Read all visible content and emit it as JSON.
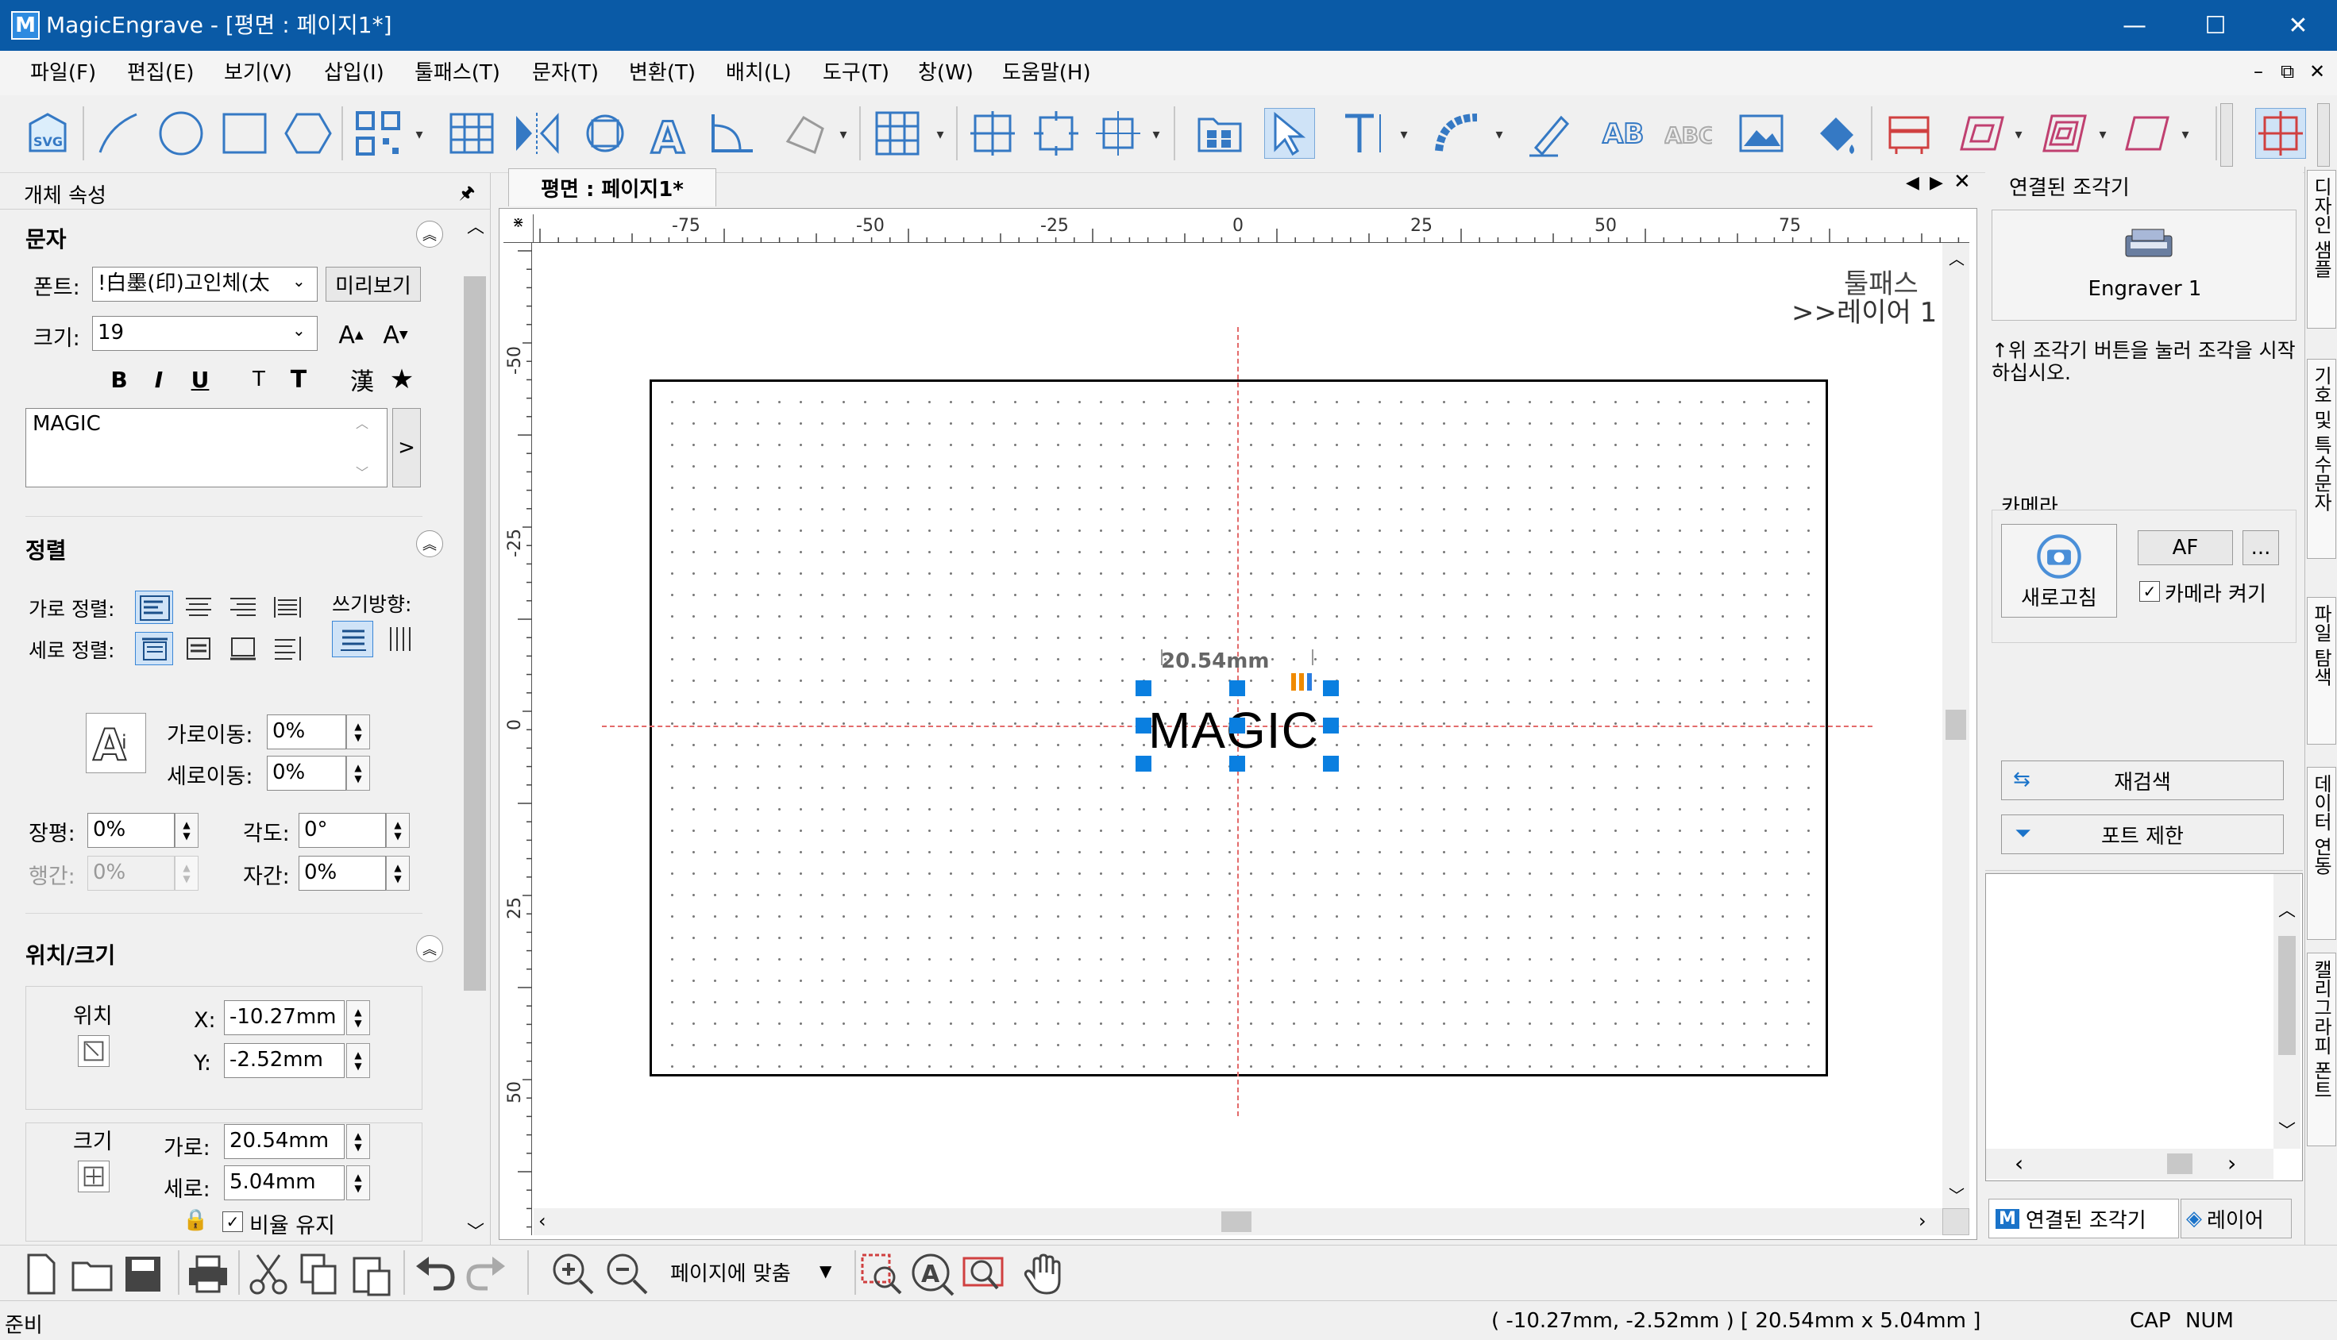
{
  "window": {
    "app_logo": "M",
    "title": "MagicEngrave - [평면 : 페이지1*]",
    "minimize": "—",
    "maximize": "☐",
    "close": "✕"
  },
  "menu": {
    "items": [
      "파일(F)",
      "편집(E)",
      "보기(V)",
      "삽입(I)",
      "툴패스(T)",
      "문자(T)",
      "변환(T)",
      "배치(L)",
      "도구(T)",
      "창(W)",
      "도움말(H)"
    ],
    "mdi_buttons": [
      "–",
      "⧉",
      "✕"
    ]
  },
  "toolbar": {
    "svg_label": "SVG",
    "icons": [
      "svg-import",
      "line",
      "circle",
      "rectangle",
      "polygon",
      "qrcode",
      "table",
      "mirror",
      "rotate",
      "text-a",
      "corner",
      "shape",
      "grid-array",
      "align-center",
      "align-distribute",
      "align-group",
      "group",
      "select-arrow",
      "text-tool",
      "arc-text",
      "pen",
      "ab-text",
      "abc-text",
      "image",
      "fill",
      "engrave-machine",
      "offset",
      "multi-offset",
      "outline",
      "crosshair"
    ]
  },
  "left_panel": {
    "title": "개체 속성",
    "pin": "🖈",
    "text_section": {
      "header": "문자",
      "font_label": "폰트:",
      "font_value": "!白墨(印)고인체(太",
      "preview_button": "미리보기",
      "size_label": "크기:",
      "size_value": "19",
      "bold": "B",
      "italic": "I",
      "underline": "U",
      "t_small": "T",
      "t_large": "T",
      "hanja": "漢",
      "star": "★",
      "text_content": "MAGIC",
      "expand": ">"
    },
    "align_section": {
      "header": "정렬",
      "h_align_label": "가로 정렬:",
      "v_align_label": "세로 정렬:",
      "direction_label": "쓰기방향:",
      "h_move_label": "가로이동:",
      "h_move_value": "0%",
      "v_move_label": "세로이동:",
      "v_move_value": "0%",
      "width_ratio_label": "장평:",
      "width_ratio_value": "0%",
      "angle_label": "각도:",
      "angle_value": "0°",
      "line_spacing_label": "행간:",
      "line_spacing_value": "0%",
      "char_spacing_label": "자간:",
      "char_spacing_value": "0%"
    },
    "position_section": {
      "header": "위치/크기",
      "position_label": "위치",
      "x_label": "X:",
      "x_value": "-10.27mm",
      "y_label": "Y:",
      "y_value": "-2.52mm",
      "size_label": "크기",
      "w_label": "가로:",
      "w_value": "20.54mm",
      "h_label": "세로:",
      "h_value": "5.04mm",
      "keep_ratio_label": "비율 유지",
      "keep_ratio_checked": true
    }
  },
  "document": {
    "tab_label": "평면 : 페이지1*",
    "nav": [
      "◀",
      "▶",
      "✕"
    ],
    "toolpath_label": "툴패스",
    "layer_label": ">>레이어 1",
    "selected_text": "MAGIC",
    "dimension_label": "20.54mm",
    "ruler_h": [
      "-75",
      "-50",
      "-25",
      "0",
      "25",
      "50",
      "75"
    ],
    "ruler_v": [
      "-50",
      "-25",
      "0",
      "25",
      "50"
    ]
  },
  "right_panel": {
    "title": "연결된 조각기",
    "engraver_name": "Engraver 1",
    "hint": "↑위 조각기 버튼을 눌러 조각을 시작하십시오.",
    "camera_title": "카메라",
    "refresh_label": "새로고침",
    "af_label": "AF",
    "more_label": "...",
    "camera_on_label": "카메라 켜기",
    "camera_on_checked": true,
    "research_label": "재검색",
    "port_limit_label": "포트 제한",
    "tab_connected": "연결된 조각기",
    "tab_layer": "레이어"
  },
  "side_tabs": [
    "디자인 샘플",
    "기호 및 특수문자",
    "파일 탐색",
    "데이터 연동",
    "캘리그라피 폰트"
  ],
  "bottom_toolbar": {
    "zoom_fit": "페이지에 맞춤"
  },
  "status": {
    "ready": "준비",
    "coords": "( -10.27mm, -2.52mm )  [ 20.54mm x 5.04mm ]",
    "cap": "CAP",
    "num": "NUM"
  },
  "colors": {
    "titlebar": "#0a5aa6",
    "selection": "#0a7fe0",
    "guide": "#e36b6b",
    "accent": "#1a73c9"
  }
}
